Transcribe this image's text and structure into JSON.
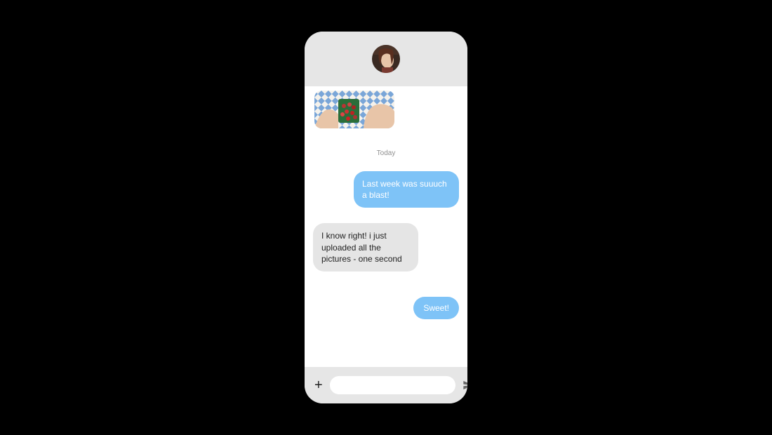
{
  "header": {
    "avatar_alt": "Contact avatar"
  },
  "chat": {
    "date_separator": "Today",
    "messages": [
      {
        "side": "out",
        "text": "Last week was suuuch a blast!"
      },
      {
        "side": "in",
        "text": "I know right! i just uploaded all the pictures - one second"
      },
      {
        "side": "out",
        "text": "Sweet!"
      }
    ]
  },
  "composer": {
    "placeholder": "",
    "value": ""
  },
  "icons": {
    "plus": "+",
    "send": "send-icon"
  },
  "colors": {
    "outgoing_bubble": "#7ec3f7",
    "incoming_bubble": "#e5e5e5",
    "phone_bg": "#e6e6e6"
  }
}
